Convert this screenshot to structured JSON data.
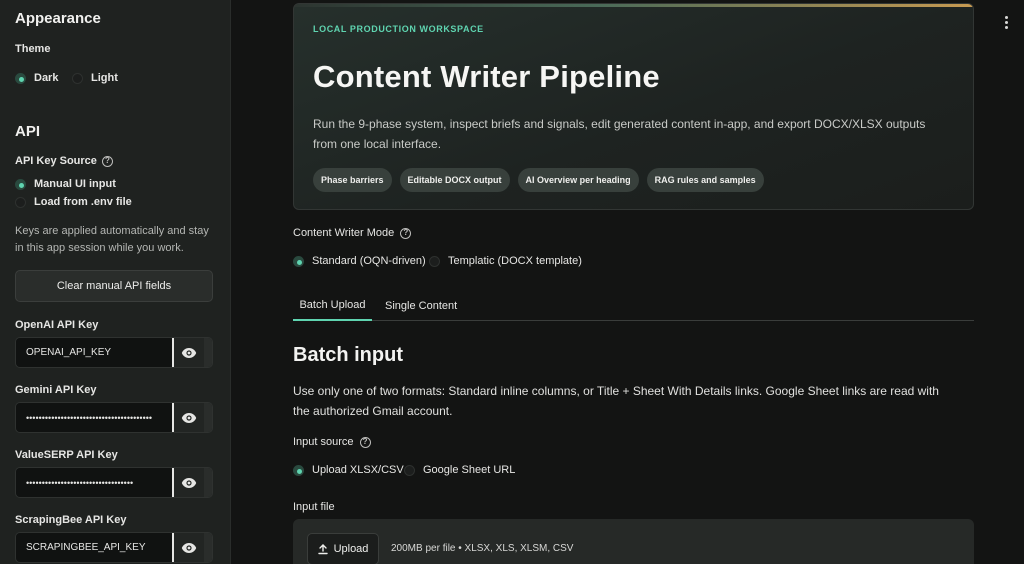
{
  "sidebar": {
    "appearance_title": "Appearance",
    "theme_label": "Theme",
    "theme_options": [
      {
        "label": "Dark",
        "selected": true
      },
      {
        "label": "Light",
        "selected": false
      }
    ],
    "api_title": "API",
    "api_key_source_label": "API Key Source",
    "api_key_source_options": [
      {
        "label": "Manual UI input",
        "selected": true
      },
      {
        "label": "Load from .env file",
        "selected": false
      }
    ],
    "api_note": "Keys are applied automatically and stay in this app session while you work.",
    "clear_button": "Clear manual API fields",
    "keys": [
      {
        "label": "OpenAI API Key",
        "value": "OPENAI_API_KEY"
      },
      {
        "label": "Gemini API Key",
        "value": "••••••••••••••••••••••••••••••••••••••••"
      },
      {
        "label": "ValueSERP API Key",
        "value": "••••••••••••••••••••••••••••••••••"
      },
      {
        "label": "ScrapingBee API Key",
        "value": "SCRAPINGBEE_API_KEY"
      }
    ]
  },
  "hero": {
    "kicker": "LOCAL PRODUCTION WORKSPACE",
    "title": "Content Writer Pipeline",
    "description": "Run the 9-phase system, inspect briefs and signals, edit generated content in-app, and export DOCX/XLSX outputs from one local interface.",
    "chips": [
      "Phase barriers",
      "Editable DOCX output",
      "AI Overview per heading",
      "RAG rules and samples"
    ]
  },
  "mode": {
    "label": "Content Writer Mode",
    "options": [
      {
        "label": "Standard (OQN-driven)",
        "selected": true
      },
      {
        "label": "Templatic (DOCX template)",
        "selected": false
      }
    ]
  },
  "tabs": [
    {
      "label": "Batch Upload",
      "active": true
    },
    {
      "label": "Single Content",
      "active": false
    }
  ],
  "batch": {
    "title": "Batch input",
    "description": "Use only one of two formats: Standard inline columns, or Title + Sheet With Details links. Google Sheet links are read with the authorized Gmail account.",
    "input_source_label": "Input source",
    "input_source_options": [
      {
        "label": "Upload XLSX/CSV",
        "selected": true
      },
      {
        "label": "Google Sheet URL",
        "selected": false
      }
    ],
    "input_file_label": "Input file",
    "upload_button": "Upload",
    "file_limit": "200MB per file • XLSX, XLS, XLSM, CSV"
  },
  "colors": {
    "accent": "#5fd4b0",
    "background": "#131413",
    "sidebar": "#1f2220"
  }
}
